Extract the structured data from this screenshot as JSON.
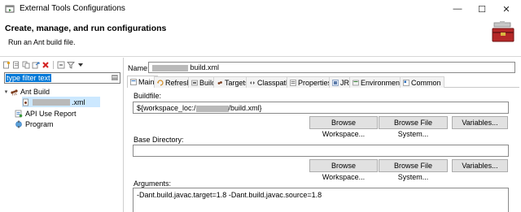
{
  "window": {
    "title": "External Tools Configurations",
    "minimize": "—",
    "maximize": "☐",
    "close": "✕"
  },
  "header": {
    "title": "Create, manage, and run configurations",
    "subtitle": "Run an Ant build file.",
    "icon": "toolbox-icon"
  },
  "sidebar": {
    "filter_placeholder": "type filter text",
    "filter_value": "type filter text",
    "clear_icon": "clear-icon",
    "toolbar_icons": [
      "new-config-icon",
      "new-prototype-icon",
      "duplicate-icon",
      "export-icon",
      "delete-icon",
      "collapse-all-icon",
      "filter-icon",
      "view-menu-icon"
    ],
    "tree": [
      {
        "label": "Ant Build",
        "expanded": true,
        "icon": "ant-icon"
      },
      {
        "label": ".xml",
        "selected": true,
        "icon": "ant-file-icon"
      },
      {
        "label": "API Use Report",
        "icon": "report-icon"
      },
      {
        "label": "Program",
        "icon": "program-icon"
      }
    ]
  },
  "main": {
    "name_label": "Name:",
    "name_value": "build.xml",
    "tabs": [
      {
        "label": "Main",
        "active": true,
        "icon": "main-tab-icon"
      },
      {
        "label": "Refresh",
        "icon": "refresh-icon"
      },
      {
        "label": "Build",
        "icon": "build-icon"
      },
      {
        "label": "Targets",
        "icon": "targets-icon"
      },
      {
        "label": "Classpath",
        "icon": "classpath-icon"
      },
      {
        "label": "Properties",
        "icon": "properties-icon"
      },
      {
        "label": "JRE",
        "icon": "jre-icon"
      },
      {
        "label": "Environment",
        "icon": "environment-icon"
      },
      {
        "label": "Common",
        "icon": "common-icon"
      }
    ],
    "buildfile_label": "Buildfile:",
    "buildfile_prefix": "${workspace_loc:/",
    "buildfile_suffix": "/build.xml}",
    "base_dir_label": "Base Directory:",
    "base_dir_value": "",
    "browse_workspace": "Browse Workspace...",
    "browse_file_system": "Browse File System...",
    "variables": "Variables...",
    "arguments_label": "Arguments:",
    "arguments_value": "-Dant.build.javac.target=1.8 -Dant.build.javac.source=1.8"
  },
  "colors": {
    "selection": "#0078d7",
    "tree_selection": "#cce8ff",
    "button_bg": "#e1e1e1"
  }
}
